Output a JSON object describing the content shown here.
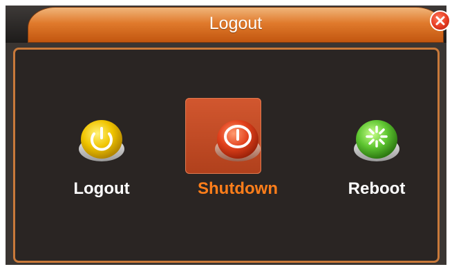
{
  "window": {
    "title": "Logout"
  },
  "actions": [
    {
      "label": "Logout",
      "icon": "power-icon",
      "color": "#f0c400",
      "selected": false
    },
    {
      "label": "Shutdown",
      "icon": "power-icon",
      "color": "#e2411c",
      "selected": true
    },
    {
      "label": "Reboot",
      "icon": "reboot-icon",
      "color": "#5ec531",
      "selected": false
    }
  ],
  "colors": {
    "accent": "#e07a2c",
    "selected_label": "#ff7e1a",
    "panel_border": "#c9793a"
  }
}
